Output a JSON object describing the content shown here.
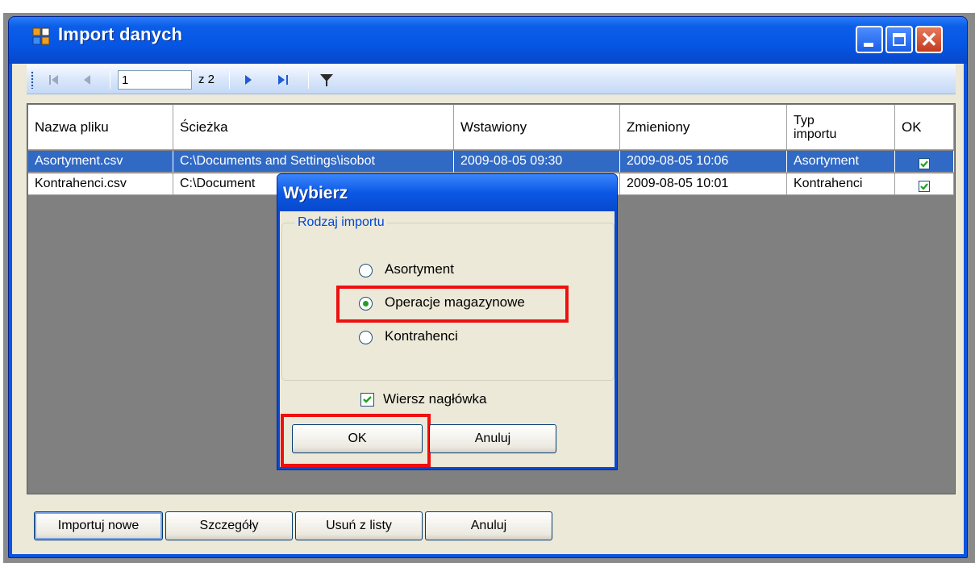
{
  "window": {
    "title": "Import danych"
  },
  "navigator": {
    "position": "1",
    "of_label": "z 2"
  },
  "grid": {
    "columns": [
      "Nazwa pliku",
      "Ścieżka",
      "Wstawiony",
      "Zmieniony",
      "Typ importu",
      "OK"
    ],
    "rows": [
      {
        "file": "Asortyment.csv",
        "path": "C:\\Documents and Settings\\isobot",
        "inserted": "2009-08-05 09:30",
        "modified": "2009-08-05 10:06",
        "type": "Asortyment",
        "ok": true,
        "selected": true
      },
      {
        "file": "Kontrahenci.csv",
        "path": "C:\\Document",
        "inserted": "",
        "modified": "2009-08-05 10:01",
        "type": "Kontrahenci",
        "ok": true,
        "selected": false
      }
    ]
  },
  "buttons": {
    "import_new": "Importuj nowe",
    "details": "Szczegóły",
    "remove": "Usuń z listy",
    "cancel": "Anuluj"
  },
  "dialog": {
    "title": "Wybierz",
    "group_label": "Rodzaj importu",
    "options": [
      "Asortyment",
      "Operacje magazynowe",
      "Kontrahenci"
    ],
    "selected_option": "Operacje magazynowe",
    "header_row_label": "Wiersz nagłówka",
    "header_row_checked": true,
    "ok_label": "OK",
    "cancel_label": "Anuluj"
  },
  "colors": {
    "title_bar": "#0656e4",
    "selection": "#316ac5",
    "highlight": "#ee1010",
    "radio_dot": "#21a121",
    "check": "#21a121"
  }
}
